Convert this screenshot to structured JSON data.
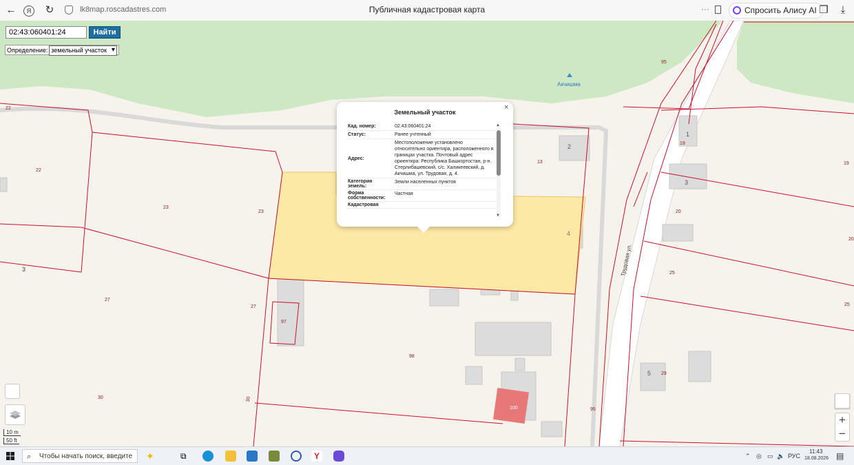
{
  "browser": {
    "url": "lk8map.roscadastres.com",
    "title": "Публичная кадастровая карта",
    "alice_label": "Спросить Алису AI"
  },
  "search": {
    "value": "02:43:060401:24",
    "button": "Найти"
  },
  "definition": {
    "label": "Определение:",
    "selected": "земельный участок"
  },
  "popup": {
    "title": "Земельный участок",
    "rows": [
      {
        "label": "Кад. номер:",
        "value": "02:43:060401:24"
      },
      {
        "label": "Статус:",
        "value": "Ранее учтенный"
      },
      {
        "label": "Адрес:",
        "value": "Местоположение установлено относительно ориентира, расположенного в границах участка. Почтовый адрес ориентира: Республика Башкортостан, р-н. Стерлибашевский, с/с. Халикеевский, д. Акчишма, ул. Трудовая, д. 4."
      },
      {
        "label": "Категория земель:",
        "value": "Земли населенных пунктов"
      },
      {
        "label": "Форма собственности:",
        "value": "Частная"
      },
      {
        "label": "Кадастровая",
        "value": ""
      }
    ]
  },
  "map": {
    "place_label": "Акчишма",
    "street_label": "Трудовая ул.",
    "parcel_numbers": [
      "22",
      "22",
      "23",
      "23",
      "3",
      "27",
      "27",
      "97",
      "98",
      "30",
      "30",
      "1",
      "19",
      "2",
      "13",
      "4",
      "3",
      "19",
      "20",
      "20",
      "25",
      "25",
      "5",
      "29",
      "95",
      "95",
      "100"
    ],
    "colors": {
      "selected_parcel": "#fde9a6",
      "highlight_building": "#e87878",
      "boundary": "#c8102e",
      "forest": "#cfe8c4"
    }
  },
  "scale": {
    "metric": "10 m",
    "imperial": "50 ft"
  },
  "zoom": {
    "plus": "+",
    "minus": "−"
  },
  "taskbar": {
    "search_placeholder": "Чтобы начать поиск, введите",
    "lang": "РУС",
    "time": "11:43",
    "date": "18.08.2026"
  }
}
